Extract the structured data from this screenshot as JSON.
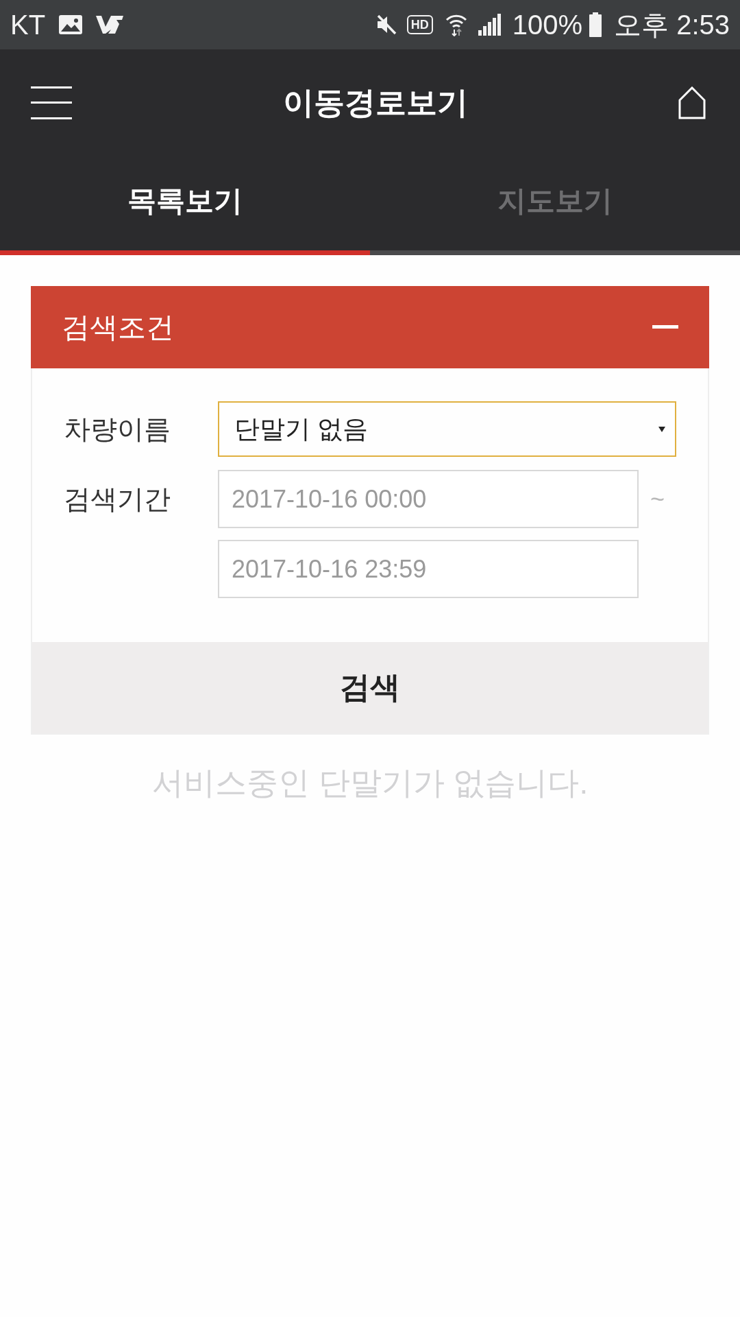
{
  "status_bar": {
    "carrier": "KT",
    "hd_label": "HD",
    "battery": "100%",
    "time": "오후 2:53"
  },
  "header": {
    "title": "이동경로보기"
  },
  "tabs": [
    {
      "label": "목록보기",
      "selected": true
    },
    {
      "label": "지도보기",
      "selected": false
    }
  ],
  "search_panel": {
    "title": "검색조건",
    "expanded": true,
    "fields": [
      {
        "kind": "select",
        "label": "차량이름",
        "value": "단말기 없음",
        "focused": true
      },
      {
        "kind": "range",
        "label": "검색기간",
        "start": "2017-10-16 00:00",
        "end": "2017-10-16 23:59",
        "separator": "~",
        "focused": false
      }
    ],
    "button": "검색"
  },
  "empty_message": "서비스중인 단말기가 없습니다."
}
